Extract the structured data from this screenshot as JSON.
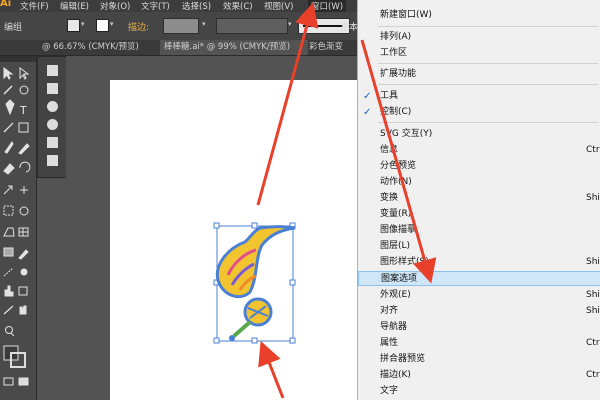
{
  "menubar": {
    "logo": "Ai",
    "items": [
      "文件(F)",
      "编辑(E)",
      "对象(O)",
      "文字(T)",
      "选择(S)",
      "效果(C)",
      "视图(V)",
      "窗口(W)"
    ]
  },
  "control_bar": {
    "group_label": "编组",
    "opacity_label": "描边:",
    "style_label": "基本"
  },
  "tabs": [
    "@ 66.67% (CMYK/预览)",
    "棒棒糖.ai* @ 99% (CMYK/预览)",
    "彩色渐变"
  ],
  "window_menu": {
    "items": [
      {
        "label": "新建窗口(W)",
        "shortcut": "",
        "checked": false
      },
      {
        "label": "排列(A)",
        "shortcut": "",
        "checked": false
      },
      {
        "label": "工作区",
        "shortcut": "",
        "checked": false
      },
      {
        "label": "扩展功能",
        "shortcut": "",
        "checked": false
      },
      {
        "label": "工具",
        "shortcut": "",
        "checked": true
      },
      {
        "label": "控制(C)",
        "shortcut": "",
        "checked": true
      },
      {
        "label": "SVG 交互(Y)",
        "shortcut": "",
        "checked": false
      },
      {
        "label": "信息",
        "shortcut": "Ctrl",
        "checked": false
      },
      {
        "label": "分色预览",
        "shortcut": "",
        "checked": false
      },
      {
        "label": "动作(N)",
        "shortcut": "",
        "checked": false
      },
      {
        "label": "变换",
        "shortcut": "Shift",
        "checked": false
      },
      {
        "label": "变量(R)",
        "shortcut": "",
        "checked": false
      },
      {
        "label": "图像描摹",
        "shortcut": "",
        "checked": false
      },
      {
        "label": "图层(L)",
        "shortcut": "",
        "checked": false
      },
      {
        "label": "图形样式(S)",
        "shortcut": "Shift",
        "checked": false
      },
      {
        "label": "图案选项",
        "shortcut": "",
        "checked": false
      },
      {
        "label": "外观(E)",
        "shortcut": "Shift",
        "checked": false
      },
      {
        "label": "对齐",
        "shortcut": "Shift",
        "checked": false
      },
      {
        "label": "导航器",
        "shortcut": "",
        "checked": false
      },
      {
        "label": "属性",
        "shortcut": "Ctrl+",
        "checked": false
      },
      {
        "label": "拼合器预览",
        "shortcut": "",
        "checked": false
      },
      {
        "label": "描边(K)",
        "shortcut": "Ctrl+",
        "checked": false
      },
      {
        "label": "文字",
        "shortcut": "",
        "checked": false
      }
    ],
    "highlighted_item": "图案选项"
  },
  "colors": {
    "ui_dark": "#535353",
    "menu_bg": "#f0f0f0",
    "highlight": "#cfe6f8",
    "arrow": "#e8402a",
    "selection": "#4a7fd6"
  },
  "icons": [
    "selection-tool-icon",
    "direct-selection-icon",
    "magic-wand-icon",
    "lasso-icon",
    "pen-icon",
    "type-icon",
    "line-icon",
    "rectangle-icon",
    "paintbrush-icon",
    "pencil-icon",
    "eraser-icon",
    "rotate-icon",
    "scale-icon",
    "width-icon",
    "free-transform-icon",
    "shape-builder-icon",
    "perspective-icon",
    "mesh-icon",
    "gradient-icon",
    "eyedropper-icon",
    "blend-icon",
    "symbol-sprayer-icon",
    "graph-icon",
    "artboard-icon",
    "slice-icon",
    "hand-icon",
    "zoom-icon",
    "fill-swatch-icon",
    "stroke-swatch-icon",
    "screen-mode-icon"
  ]
}
